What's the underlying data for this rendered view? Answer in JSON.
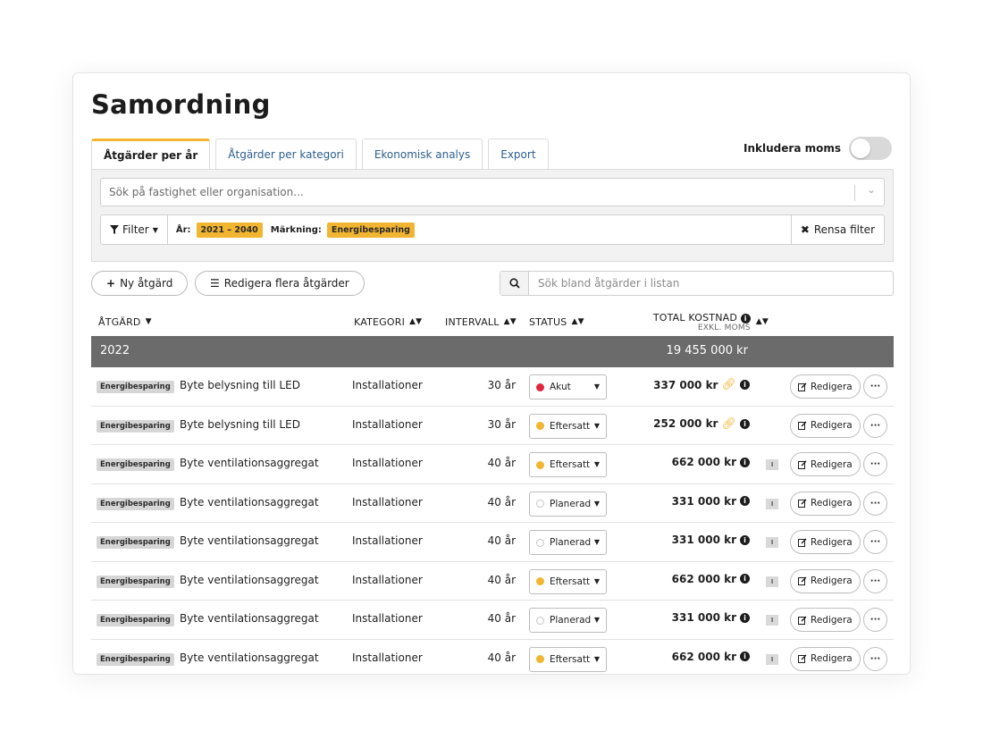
{
  "page": {
    "title": "Samordning"
  },
  "tabs": [
    {
      "label": "Åtgärder per år"
    },
    {
      "label": "Åtgärder per kategori"
    },
    {
      "label": "Ekonomisk analys"
    },
    {
      "label": "Export"
    }
  ],
  "moms_toggle": {
    "label": "Inkludera moms",
    "on": false
  },
  "search": {
    "placeholder": "Sök på fastighet eller organisation..."
  },
  "filters": {
    "filter_button": "Filter",
    "year_label": "År:",
    "year_value": "2021 – 2040",
    "marking_label": "Märkning:",
    "marking_value": "Energibesparing",
    "clear_label": "Rensa filter"
  },
  "actions": {
    "new_label": "Ny åtgärd",
    "bulk_edit_label": "Redigera flera åtgärder",
    "list_search_placeholder": "Sök bland åtgärder i listan"
  },
  "table": {
    "columns": {
      "action": "ÅTGÄRD",
      "category": "KATEGORI",
      "interval": "INTERVALL",
      "status": "STATUS",
      "total": "TOTAL KOSTNAD",
      "total_sub": "EXKL. MOMS"
    },
    "group": {
      "year": "2022",
      "total": "19 455 000 kr"
    },
    "edit_label": "Redigera",
    "rows": [
      {
        "tag": "Energibesparing",
        "name": "Byte belysning till LED",
        "category": "Installationer",
        "interval": "30 år",
        "status": "Akut",
        "status_color": "#e0263e",
        "cost": "337 000 kr",
        "linked": true
      },
      {
        "tag": "Energibesparing",
        "name": "Byte belysning till LED",
        "category": "Installationer",
        "interval": "30 år",
        "status": "Eftersatt",
        "status_color": "#f2b531",
        "cost": "252 000 kr",
        "linked": true
      },
      {
        "tag": "Energibesparing",
        "name": "Byte ventilationsaggregat",
        "category": "Installationer",
        "interval": "40 år",
        "status": "Eftersatt",
        "status_color": "#f2b531",
        "cost": "662 000 kr",
        "linked": false
      },
      {
        "tag": "Energibesparing",
        "name": "Byte ventilationsaggregat",
        "category": "Installationer",
        "interval": "40 år",
        "status": "Planerad",
        "status_color": "#ffffff",
        "cost": "331 000 kr",
        "linked": false
      },
      {
        "tag": "Energibesparing",
        "name": "Byte ventilationsaggregat",
        "category": "Installationer",
        "interval": "40 år",
        "status": "Planerad",
        "status_color": "#ffffff",
        "cost": "331 000 kr",
        "linked": false
      },
      {
        "tag": "Energibesparing",
        "name": "Byte ventilationsaggregat",
        "category": "Installationer",
        "interval": "40 år",
        "status": "Eftersatt",
        "status_color": "#f2b531",
        "cost": "662 000 kr",
        "linked": false
      },
      {
        "tag": "Energibesparing",
        "name": "Byte ventilationsaggregat",
        "category": "Installationer",
        "interval": "40 år",
        "status": "Planerad",
        "status_color": "#ffffff",
        "cost": "331 000 kr",
        "linked": false
      },
      {
        "tag": "Energibesparing",
        "name": "Byte ventilationsaggregat",
        "category": "Installationer",
        "interval": "40 år",
        "status": "Eftersatt",
        "status_color": "#f2b531",
        "cost": "662 000 kr",
        "linked": false
      }
    ]
  },
  "colors": {
    "accent": "#f2b531",
    "group_row": "#6b6b6b",
    "tab_link": "#2d5f8d"
  }
}
